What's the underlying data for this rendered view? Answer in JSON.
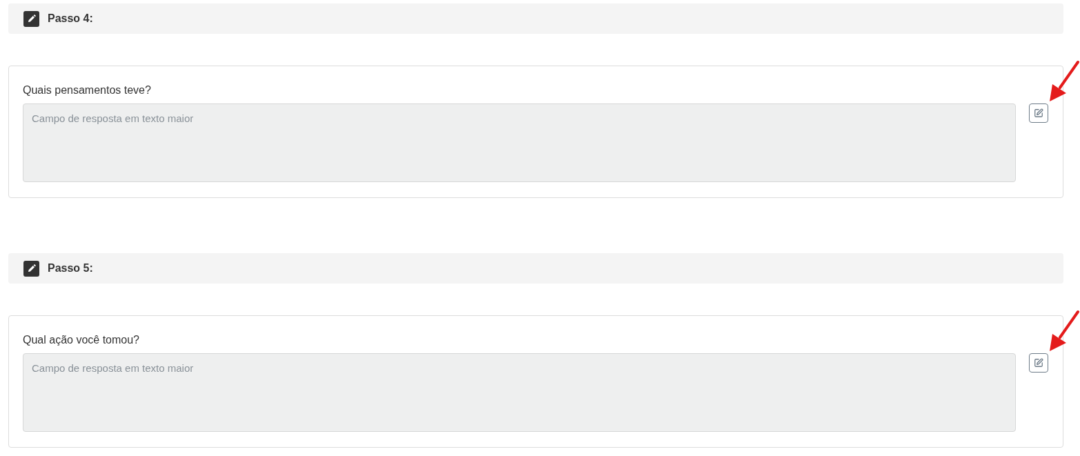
{
  "steps": [
    {
      "title": "Passo 4:",
      "question": {
        "label": "Quais pensamentos teve?",
        "placeholder": "Campo de resposta em texto maior",
        "arrow": true
      }
    },
    {
      "title": "Passo 5:",
      "question": {
        "label": "Qual ação você tomou?",
        "placeholder": "Campo de resposta em texto maior",
        "arrow": true
      }
    }
  ]
}
